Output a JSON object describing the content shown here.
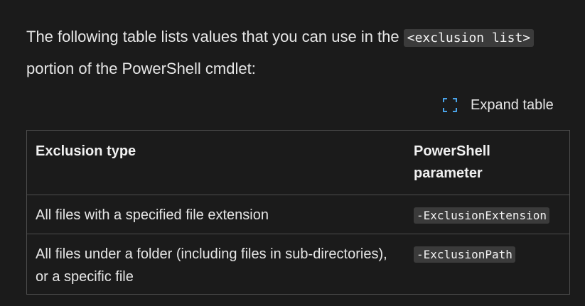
{
  "intro": {
    "text_before": "The following table lists values that you can use in the ",
    "code": "<exclusion list>",
    "text_after": " portion of the PowerShell cmdlet:"
  },
  "expand_table": {
    "label": "Expand table",
    "icon": "expand-icon"
  },
  "table": {
    "headers": [
      "Exclusion type",
      "PowerShell parameter"
    ],
    "rows": [
      {
        "type": "All files with a specified file extension",
        "parameter": "-ExclusionExtension"
      },
      {
        "type": "All files under a folder (including files in sub-directories), or a specific file",
        "parameter": "-ExclusionPath"
      }
    ]
  },
  "colors": {
    "background": "#1b1b1b",
    "text": "#e6e6e6",
    "code_background": "#3b3b3b",
    "border": "#4d4d4d"
  }
}
